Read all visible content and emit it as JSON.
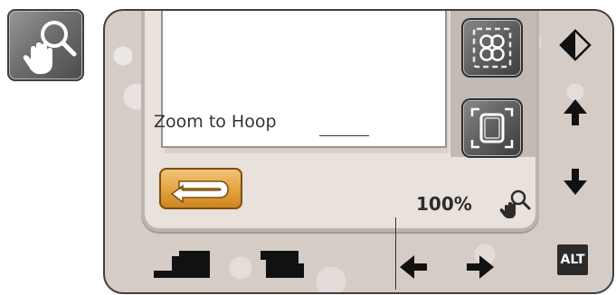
{
  "callouts": {
    "zoom_to_hoop": "Zoom to Hoop"
  },
  "status": {
    "zoom_percent": "100%"
  },
  "keys": {
    "alt_label": "ALT"
  },
  "icons": {
    "external": "zoom-pan-icon",
    "hoop_grid": "zoom-to-all-icon",
    "hoop_rect": "zoom-to-hoop-icon",
    "back": "back-arrow-icon",
    "mirror": "mirror-icon",
    "up": "arrow-up-icon",
    "down": "arrow-down-icon",
    "left": "arrow-left-icon",
    "right": "arrow-right-icon",
    "presser_down": "presser-foot-down-icon",
    "presser_up": "presser-foot-up-icon"
  },
  "colors": {
    "panel_bg": "#d6ccc6",
    "back_button": "#e4a13f",
    "icon_button": "#5e5e5e"
  }
}
